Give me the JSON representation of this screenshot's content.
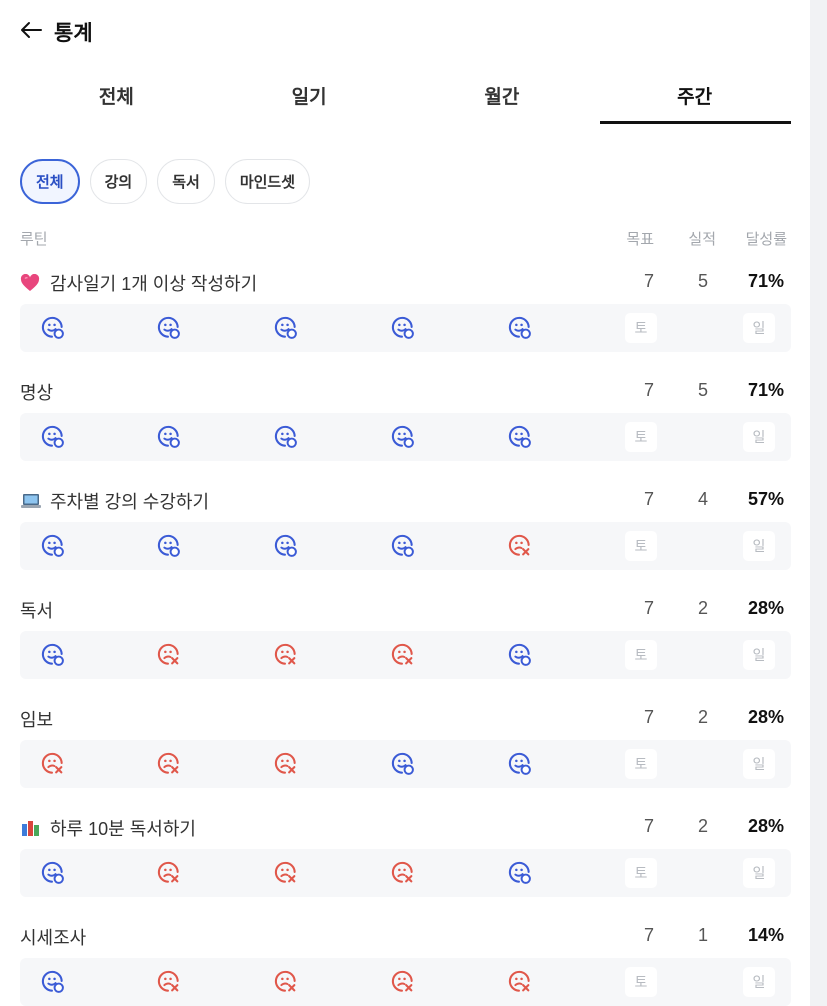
{
  "header": {
    "title": "통계"
  },
  "tabs": [
    {
      "label": "전체",
      "active": false
    },
    {
      "label": "일기",
      "active": false
    },
    {
      "label": "월간",
      "active": false
    },
    {
      "label": "주간",
      "active": true
    }
  ],
  "chips": [
    {
      "label": "전체",
      "active": true
    },
    {
      "label": "강의",
      "active": false
    },
    {
      "label": "독서",
      "active": false
    },
    {
      "label": "마인드셋",
      "active": false
    }
  ],
  "columns": {
    "routine": "루틴",
    "goal": "목표",
    "actual": "실적",
    "rate": "달성률"
  },
  "colors": {
    "success": "#3b5bd6",
    "fail": "#e0574a",
    "accent": "#3b64d8"
  },
  "routines": [
    {
      "name": "감사일기 1개 이상 작성하기",
      "icon": "heart-icon",
      "goal": "7",
      "actual": "5",
      "rate": "71%",
      "days": [
        "success",
        "success",
        "success",
        "success",
        "success",
        "토",
        "일"
      ]
    },
    {
      "name": "명상",
      "icon": "",
      "goal": "7",
      "actual": "5",
      "rate": "71%",
      "days": [
        "success",
        "success",
        "success",
        "success",
        "success",
        "토",
        "일"
      ]
    },
    {
      "name": "주차별 강의 수강하기",
      "icon": "laptop-icon",
      "goal": "7",
      "actual": "4",
      "rate": "57%",
      "days": [
        "success",
        "success",
        "success",
        "success",
        "fail",
        "토",
        "일"
      ]
    },
    {
      "name": "독서",
      "icon": "",
      "goal": "7",
      "actual": "2",
      "rate": "28%",
      "days": [
        "success",
        "fail",
        "fail",
        "fail",
        "success",
        "토",
        "일"
      ]
    },
    {
      "name": "임보",
      "icon": "",
      "goal": "7",
      "actual": "2",
      "rate": "28%",
      "days": [
        "fail",
        "fail",
        "fail",
        "success",
        "success",
        "토",
        "일"
      ]
    },
    {
      "name": "하루 10분 독서하기",
      "icon": "books-icon",
      "goal": "7",
      "actual": "2",
      "rate": "28%",
      "days": [
        "success",
        "fail",
        "fail",
        "fail",
        "success",
        "토",
        "일"
      ]
    },
    {
      "name": "시세조사",
      "icon": "",
      "goal": "7",
      "actual": "1",
      "rate": "14%",
      "days": [
        "success",
        "fail",
        "fail",
        "fail",
        "fail",
        "토",
        "일"
      ]
    }
  ]
}
